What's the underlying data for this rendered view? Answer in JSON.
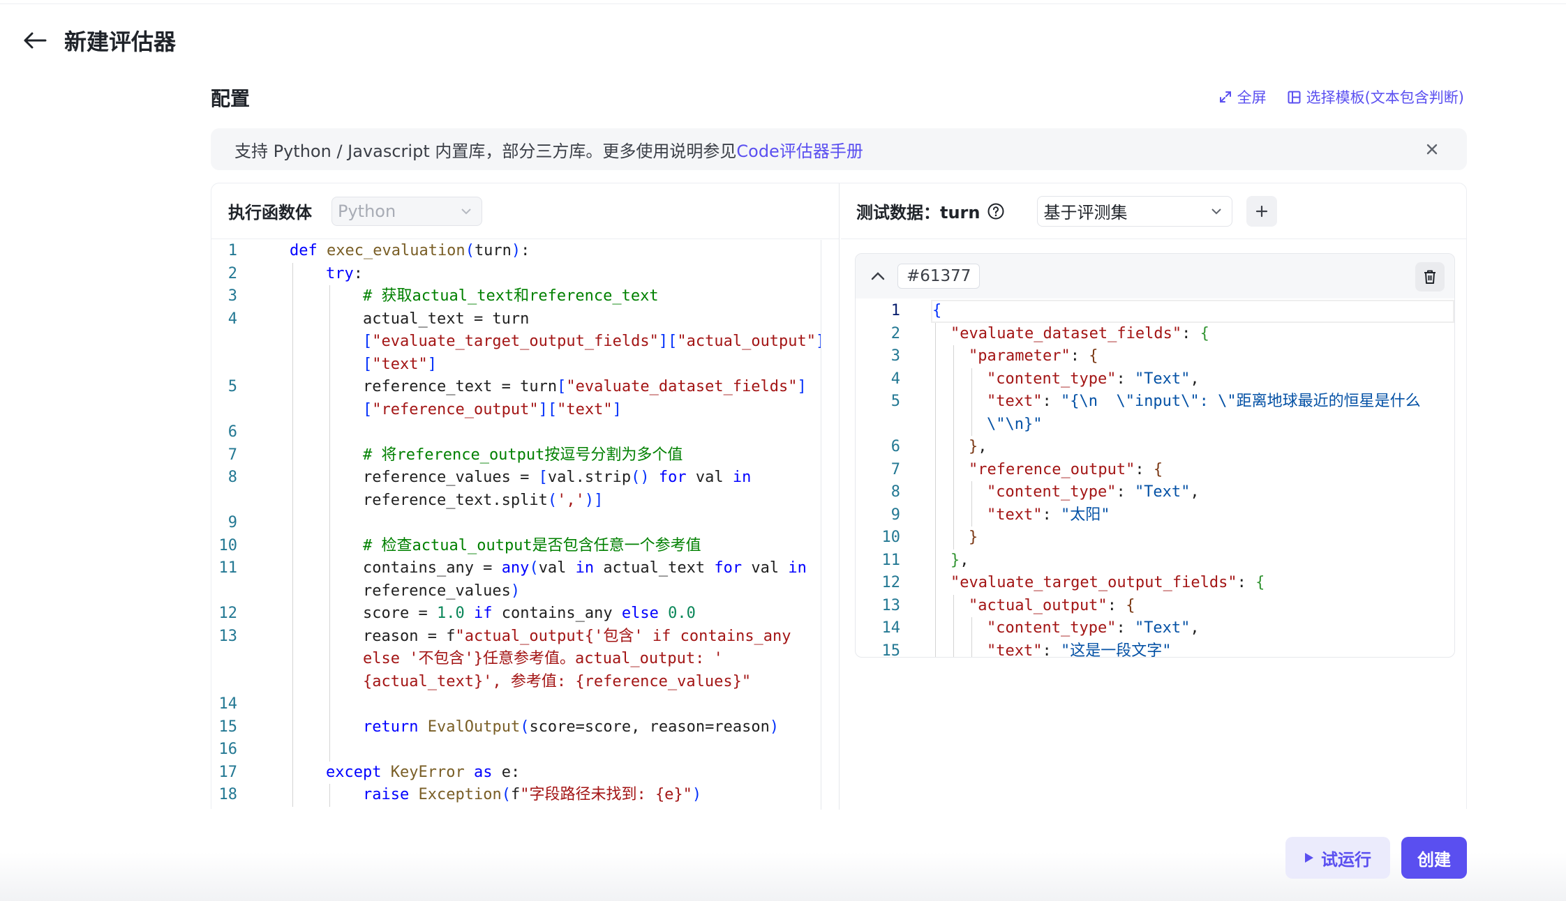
{
  "header": {
    "title": "新建评估器"
  },
  "section": {
    "title": "配置"
  },
  "actions": {
    "fullscreen": "全屏",
    "template": "选择模板(文本包含判断)"
  },
  "notice": {
    "text": "支持 Python / Javascript 内置库，部分三方库。更多使用说明参见",
    "link": "Code评估器手册"
  },
  "left": {
    "label": "执行函数体",
    "language": "Python"
  },
  "right": {
    "label": "测试数据：turn",
    "source": "基于评测集",
    "sample_id": "#61377"
  },
  "footer": {
    "run": "试运行",
    "create": "创建"
  },
  "code_line_numbers": [
    "1",
    "2",
    "3",
    "4",
    "5",
    "6",
    "7",
    "8",
    "9",
    "10",
    "11",
    "12",
    "13",
    "14",
    "15",
    "16",
    "17",
    "18"
  ],
  "json_line_numbers": [
    "1",
    "2",
    "3",
    "4",
    "5",
    "6",
    "7",
    "8",
    "9",
    "10",
    "11",
    "12",
    "13",
    "14",
    "15"
  ],
  "colors": {
    "accent": "#5a4ff0",
    "keyword": "#0000ff",
    "string": "#a31515",
    "comment": "#008000"
  }
}
